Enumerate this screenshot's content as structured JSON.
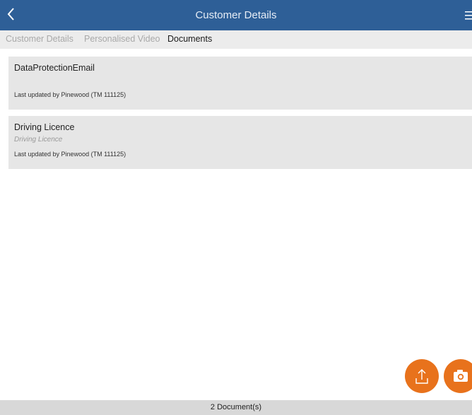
{
  "header": {
    "title": "Customer Details",
    "back_icon": "chevron-left-icon",
    "menu_icon": "hamburger-menu-icon",
    "bg_color": "#2e5f97"
  },
  "tabs": [
    {
      "label": "Customer Details",
      "active": false
    },
    {
      "label": "Personalised Video",
      "active": false
    },
    {
      "label": "Documents",
      "active": true
    }
  ],
  "documents": [
    {
      "title": "DataProtectionEmail",
      "subtitle": "",
      "updated": "Last updated by Pinewood (TM 111125)"
    },
    {
      "title": "Driving Licence",
      "subtitle": "Driving Licence",
      "updated": "Last updated by Pinewood (TM 111125)"
    }
  ],
  "actions": {
    "upload_icon": "upload-icon",
    "camera_icon": "camera-icon",
    "accent_color": "#e8721c"
  },
  "footer": {
    "count_text": "2 Document(s)"
  }
}
